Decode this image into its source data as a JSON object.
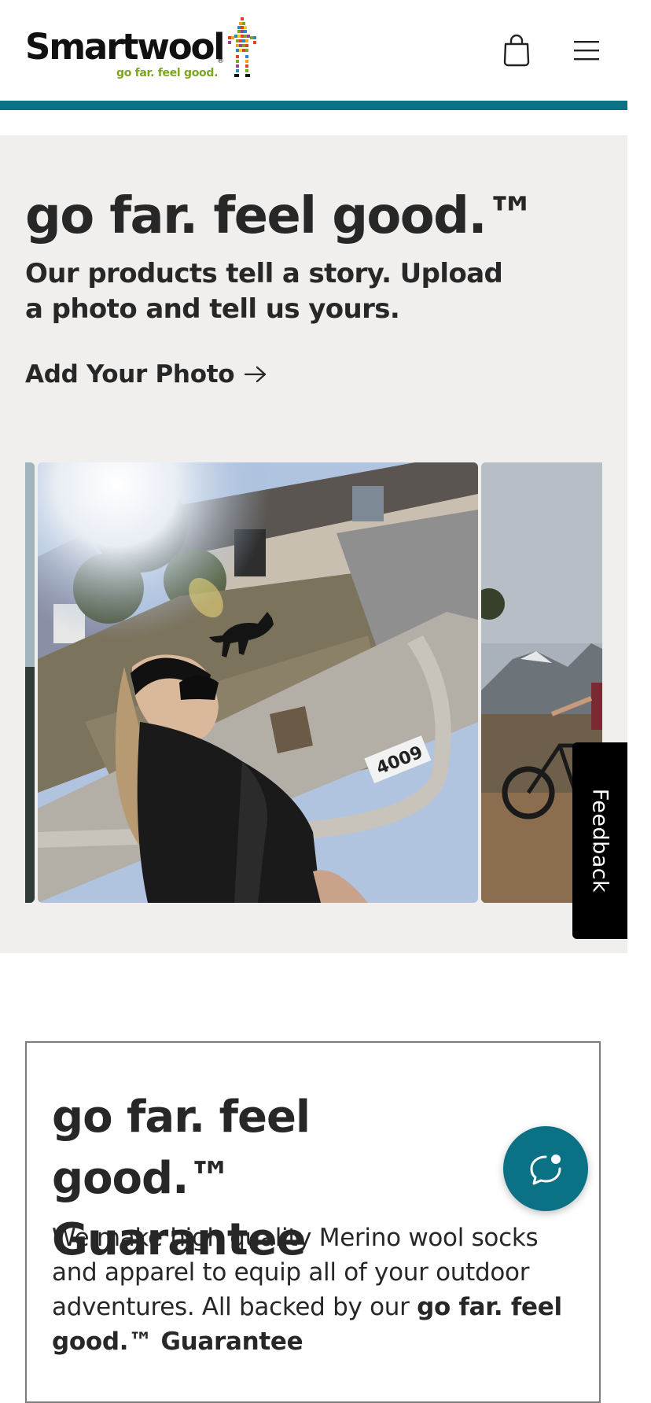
{
  "header": {
    "logo_text": "Smartwool",
    "logo_registered": "®",
    "logo_tagline": "go far. feel good.",
    "cart_icon": "shopping-bag-icon",
    "menu_icon": "hamburger-menu-icon",
    "accent_color": "#0b7285"
  },
  "hero": {
    "title": "go far. feel good.™",
    "subtitle": "Our products tell a story. Upload a photo and tell us yours.",
    "cta_label": "Add Your Photo",
    "cta_icon": "arrow-right-icon",
    "background_color": "#f1efed"
  },
  "carousel": {
    "slides": [
      {
        "icon": "photo-partial-left"
      },
      {
        "icon": "photo-woman-headband-dog-sidewalk",
        "curb_number": "4009"
      },
      {
        "icon": "photo-mountain-bikers-partial"
      }
    ]
  },
  "feedback": {
    "label": "Feedback"
  },
  "guarantee": {
    "title": "go far. feel good.™ Guarantee",
    "body_start": "We make high quality Merino wool socks and apparel to equip all of your outdoor adventures. All backed by our ",
    "body_bold": "go far. feel good.™ Guarantee"
  },
  "chat": {
    "icon": "chat-bubble-icon",
    "color": "#0b7285"
  }
}
